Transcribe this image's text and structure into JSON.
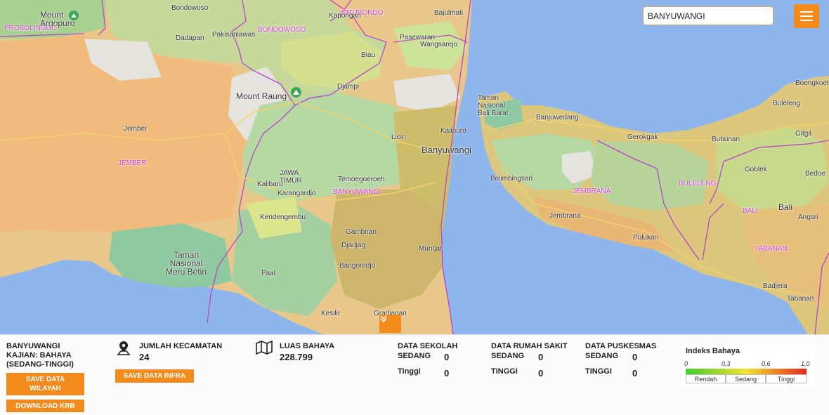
{
  "search": {
    "value": "BANYUWANGI"
  },
  "map_labels": {
    "mount_argopuro": "Mount\nArgopuro",
    "probolinggo": "PROBOLINGGO",
    "bondowoso_town": "Bondowoso",
    "situbondo": "SITUBONDO",
    "kapongan": "Kapongan",
    "bajulmati": "Bajulmati",
    "dadapan": "Dadapan",
    "pakisanlawas": "Pakisanlawas",
    "bondowoso": "BONDOWOSO",
    "pasewaran": "Pasewaran",
    "wangsarejo": "Wangsarejo",
    "biau": "Biau",
    "mount_raung": "Mount Raung",
    "djampi": "Djampi",
    "jember_town": "Jember",
    "jember": "JEMBER",
    "licin": "Licin",
    "kalipuro": "Kalipuro",
    "banyuwangi_city": "Banyuwangi",
    "jawa_timur": "JAWA\nTIMUR",
    "kalibaru": "Kalibaru",
    "karangardjo": "Karangardjo",
    "temoegoeroeh": "Temoegoeroeh",
    "banyuwangi": "BANYUWANGI",
    "kendengembu": "Kendengembu",
    "gambiran": "Gambiran",
    "djadjag": "Djadjag",
    "muntjar": "Muntjar",
    "bangoredjo": "Bangoredjo",
    "taman_meru_betiri": "Taman\nNasional\nMeru Betiri",
    "paal": "Paal",
    "kesilir": "Kesilir",
    "gradjagan": "Gradjagan",
    "taman_bali_barat": "Taman\nNasional\nBali Barat",
    "banjuwedang": "Banjuwedang",
    "belimbingsari": "Belimbingsari",
    "jembrana": "JEMBRANA",
    "jembrana_town": "Jembrana",
    "pulukan": "Pulukan",
    "gerokgak": "Gerokgak",
    "bubunan": "Bubunan",
    "goblek": "Goblek",
    "buleleng": "BULELENG",
    "buleleng_town": "Buleleng",
    "bali_admin": "BALI",
    "bali": "Bali",
    "angsri": "Angsri",
    "tabanan": "TABANAN",
    "tabanan_town": "Tabanan",
    "badjera": "Badjera",
    "boengkoelan": "Boengkoel",
    "gitgit": "Gitgit",
    "bedoegoel": "Bedoe"
  },
  "panel": {
    "region_name": "BANYUWANGI",
    "kajian": "KAJIAN: BAHAYA (SEDANG-TINGGI)",
    "save_wilayah": "SAVE DATA WILAYAH",
    "download_krb": "DOWNLOAD KRB",
    "kecamatan_label": "JUMLAH KECAMATAN",
    "kecamatan_value": "24",
    "save_infra": "SAVE DATA INFRA",
    "luas_label": "LUAS BAHAYA",
    "luas_value": "228.799",
    "sekolah": {
      "title": "DATA SEKOLAH",
      "sedang_label": "SEDANG",
      "sedang_value": "0",
      "tinggi_label": "Tinggi",
      "tinggi_value": "0"
    },
    "rumah_sakit": {
      "title": "DATA RUMAH SAKIT",
      "sedang_label": "SEDANG",
      "sedang_value": "0",
      "tinggi_label": "TINGGI",
      "tinggi_value": "0"
    },
    "puskesmas": {
      "title": "DATA PUSKESMAS",
      "sedang_label": "SEDANG",
      "sedang_value": "0",
      "tinggi_label": "TINGGI",
      "tinggi_value": "0"
    }
  },
  "legend": {
    "title": "Indeks Bahaya",
    "ticks": [
      "0",
      "0,3",
      "0,6",
      "1,0"
    ],
    "categories": [
      "Rendah",
      "Sedang",
      "Tinggi"
    ],
    "gradient_colors": [
      "#3ccf2a",
      "#f4e22c",
      "#e6261d"
    ]
  },
  "colors": {
    "accent": "#f38a1c",
    "sea": "#8fb6ec",
    "boundary": "#b845c9"
  },
  "icons": {
    "menu": "hamburger-icon",
    "collapse": "chevrons-down-icon",
    "kecamatan": "map-pin-icon",
    "luas": "map-icon",
    "mountain": "mountain-icon"
  }
}
